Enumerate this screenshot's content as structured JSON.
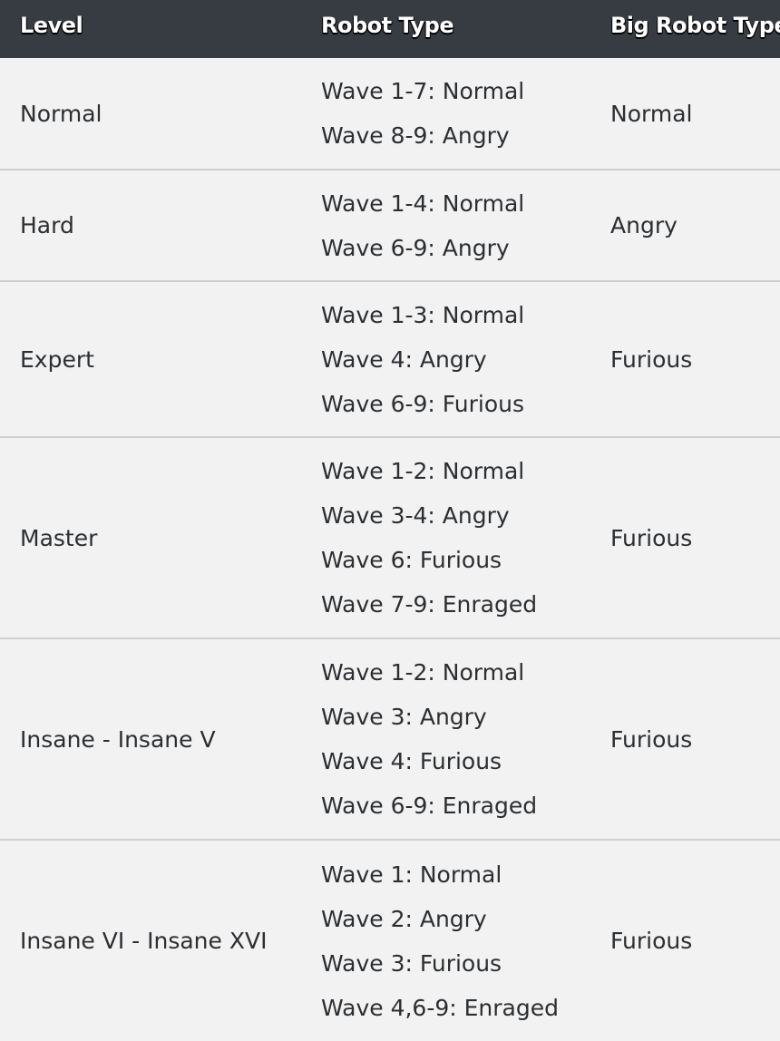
{
  "headers": {
    "level": "Level",
    "robot_type": "Robot Type",
    "big_robot_type": "Big Robot Type"
  },
  "rows": [
    {
      "level": "Normal",
      "robot_types": [
        "Wave 1-7: Normal",
        "Wave 8-9: Angry"
      ],
      "big_robot_type": "Normal"
    },
    {
      "level": "Hard",
      "robot_types": [
        "Wave 1-4: Normal",
        "Wave 6-9: Angry"
      ],
      "big_robot_type": "Angry"
    },
    {
      "level": "Expert",
      "robot_types": [
        "Wave 1-3: Normal",
        "Wave 4: Angry",
        "Wave 6-9: Furious"
      ],
      "big_robot_type": "Furious"
    },
    {
      "level": "Master",
      "robot_types": [
        "Wave 1-2: Normal",
        "Wave 3-4: Angry",
        "Wave 6: Furious",
        "Wave 7-9: Enraged"
      ],
      "big_robot_type": "Furious"
    },
    {
      "level": "Insane - Insane V",
      "robot_types": [
        "Wave 1-2: Normal",
        "Wave 3: Angry",
        "Wave 4: Furious",
        "Wave 6-9: Enraged"
      ],
      "big_robot_type": "Furious"
    },
    {
      "level": "Insane VI - Insane XVI",
      "robot_types": [
        "Wave 1: Normal",
        "Wave 2: Angry",
        "Wave 3: Furious",
        "Wave 4,6-9: Enraged"
      ],
      "big_robot_type": "Furious"
    }
  ],
  "colors": {
    "header_bg": "#373c43",
    "row_bg": "#f2f2f2",
    "divider": "#cfcfcf",
    "text": "#2b2f33"
  }
}
